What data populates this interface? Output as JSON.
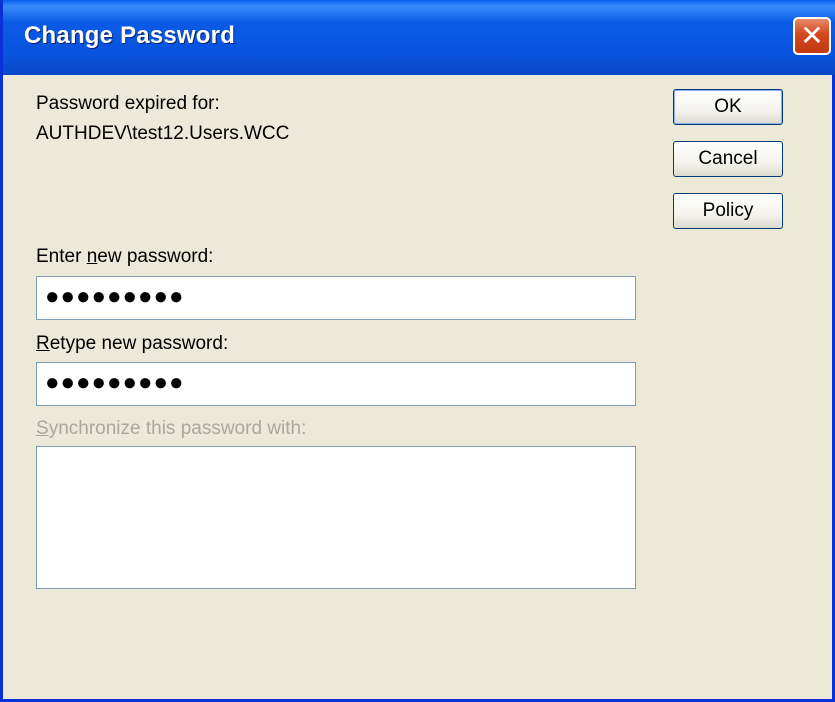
{
  "window": {
    "title": "Change Password",
    "close_glyph": "✕"
  },
  "info": {
    "expired_label": "Password expired for:",
    "account": "AUTHDEV\\test12.Users.WCC"
  },
  "buttons": {
    "ok": "OK",
    "cancel": "Cancel",
    "policy": "Policy"
  },
  "fields": {
    "new_password": {
      "label_prefix": "Enter ",
      "label_accel": "n",
      "label_suffix": "ew password:",
      "value": "●●●●●●●●●"
    },
    "retype_password": {
      "label_accel": "R",
      "label_suffix": "etype new password:",
      "value": "●●●●●●●●●"
    },
    "sync": {
      "label_accel": "S",
      "label_suffix": "ynchronize this password with:",
      "items": []
    }
  },
  "colors": {
    "titlebar": "#0853e0",
    "dialog_bg": "#ece9d8",
    "close_button": "#d4481d",
    "disabled_text": "#aca899"
  }
}
